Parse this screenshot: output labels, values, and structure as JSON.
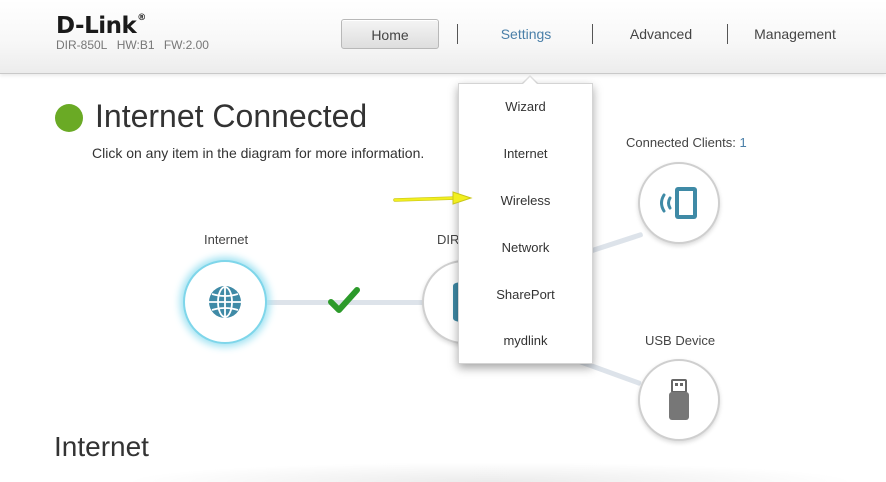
{
  "header": {
    "logo": "D-Link",
    "logo_mark": "®",
    "model": "DIR-850L",
    "hw": "HW:B1",
    "fw": "FW:2.00"
  },
  "nav": {
    "home": "Home",
    "settings": "Settings",
    "advanced": "Advanced",
    "management": "Management"
  },
  "status": {
    "title": "Internet Connected",
    "hint": "Click on any item in the diagram for more information.",
    "color": "#6aaa25"
  },
  "diagram": {
    "internet_label": "Internet",
    "router_label": "DIR",
    "clients_label": "Connected Clients:",
    "clients_count": "1",
    "usb_label": "USB Device"
  },
  "settings_menu": {
    "items": [
      "Wizard",
      "Internet",
      "Wireless",
      "Network",
      "SharePort",
      "mydlink"
    ],
    "highlighted": "Wireless"
  },
  "section": {
    "title": "Internet"
  },
  "icons": [
    "globe-icon",
    "router-icon",
    "wireless-device-icon",
    "usb-drive-icon",
    "checkmark-icon",
    "pointer-arrow-icon"
  ],
  "colors": {
    "accent": "#4a7fa8",
    "connected": "#6aaa25",
    "glow": "#7fd6ea",
    "arrow": "#f2ef1e"
  }
}
